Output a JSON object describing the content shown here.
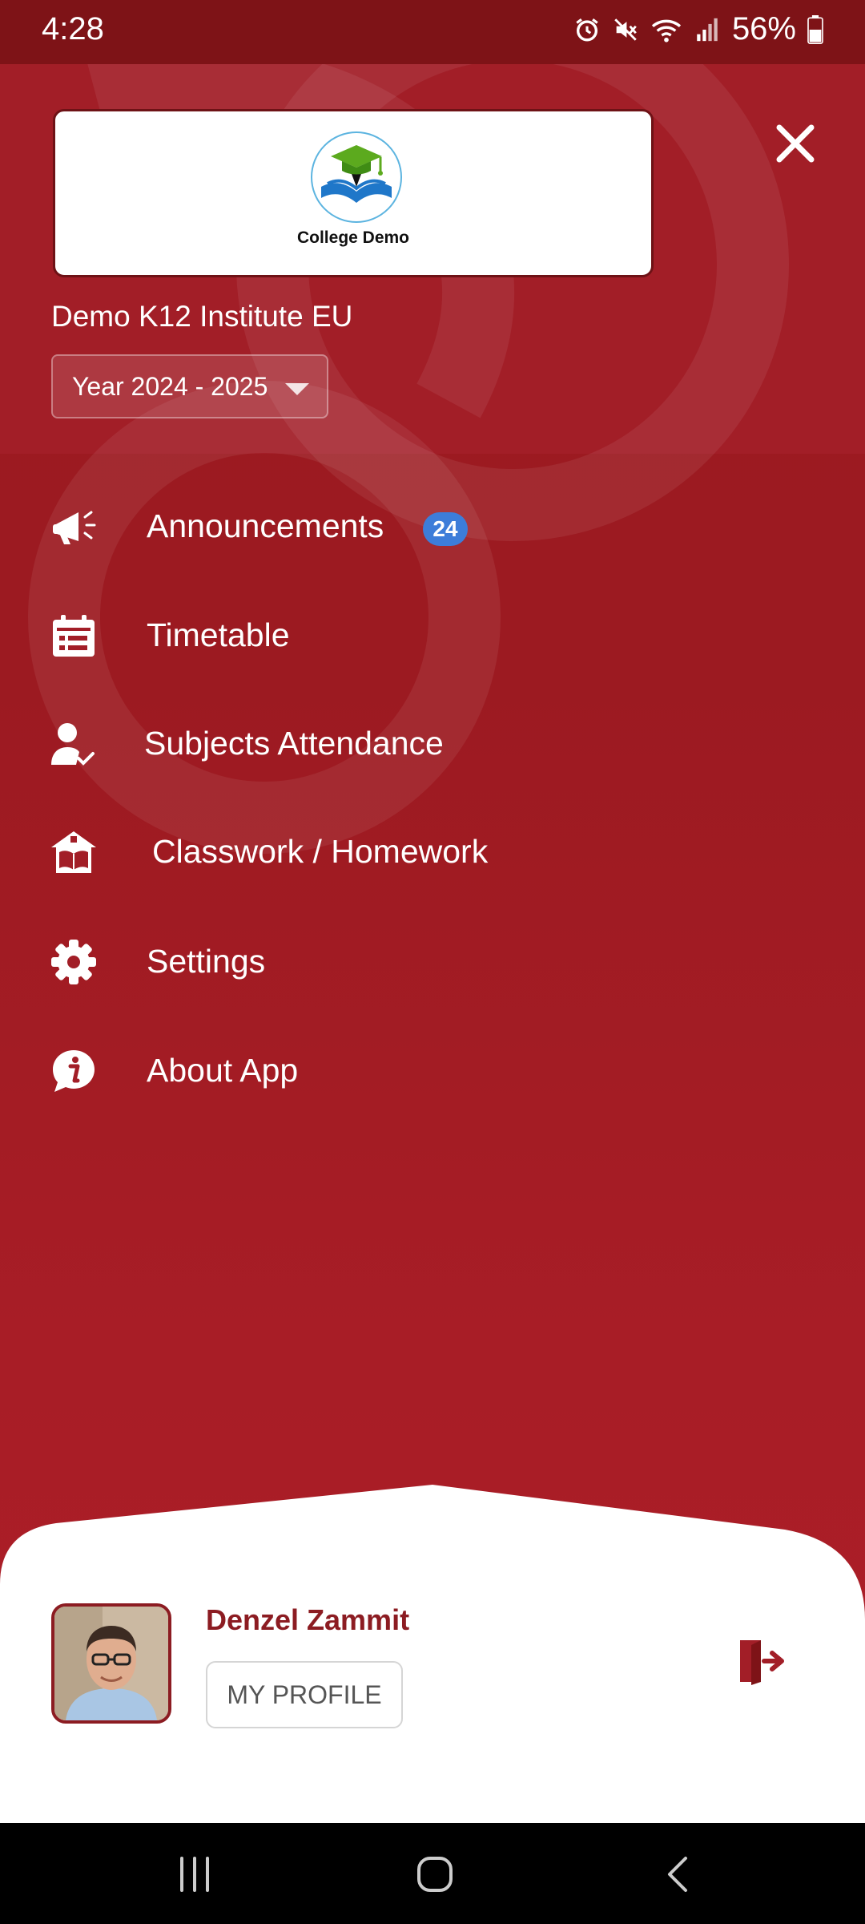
{
  "status_bar": {
    "time": "4:28",
    "battery": "56%",
    "icons": [
      "alarm-icon",
      "mute-icon",
      "wifi-icon",
      "signal-icon",
      "battery-icon"
    ]
  },
  "header": {
    "logo_caption": "College Demo",
    "institution": "Demo K12 Institute EU",
    "year_selector": "Year 2024 - 2025"
  },
  "menu": {
    "items": [
      {
        "label": "Announcements",
        "icon": "megaphone-icon",
        "badge": "24"
      },
      {
        "label": "Timetable",
        "icon": "calendar-icon"
      },
      {
        "label": "Subjects Attendance",
        "icon": "user-check-icon"
      },
      {
        "label": "Classwork / Homework",
        "icon": "school-book-icon"
      },
      {
        "label": "Settings",
        "icon": "gear-icon"
      },
      {
        "label": "About App",
        "icon": "info-icon"
      }
    ]
  },
  "profile": {
    "name": "Denzel Zammit",
    "button_label": "MY PROFILE"
  },
  "colors": {
    "primary": "#9c1a21",
    "status_bar": "#7e1317",
    "badge": "#3d7dd9",
    "profile_name": "#8c1c22"
  }
}
